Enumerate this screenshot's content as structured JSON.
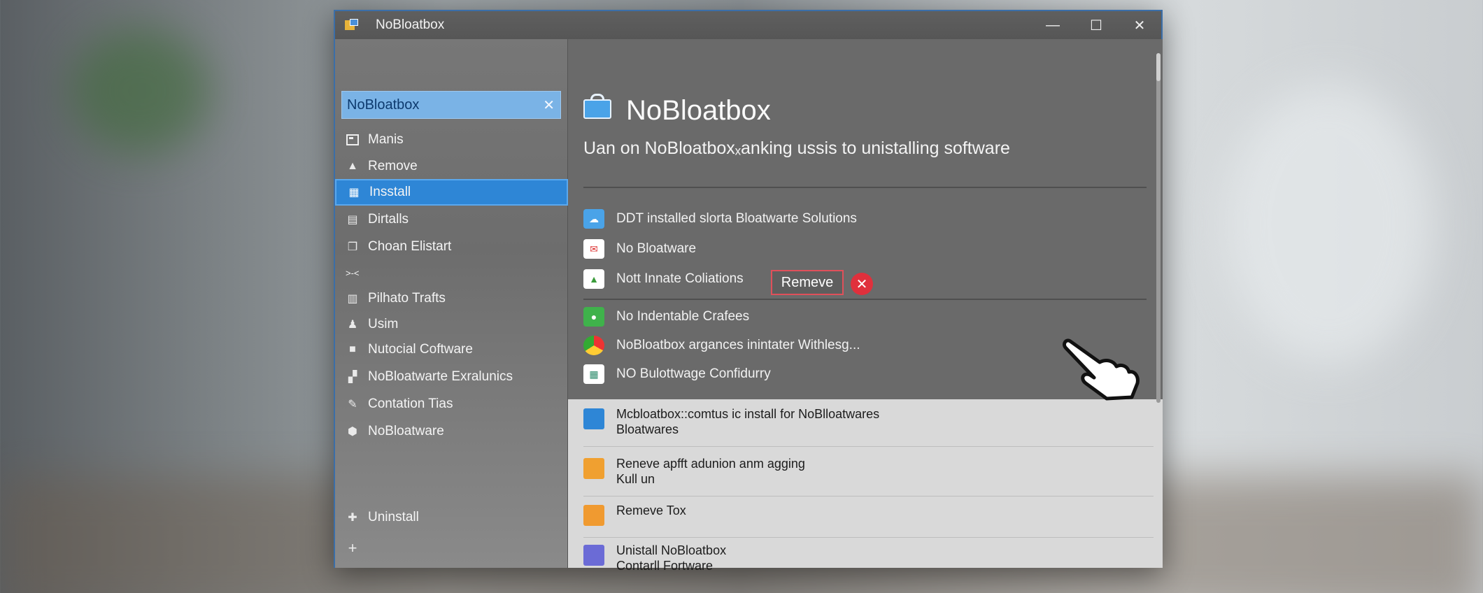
{
  "window": {
    "title": "NoBloatbox",
    "controls": {
      "minimize": "—",
      "maximize": "☐",
      "close": "✕"
    }
  },
  "sidebar": {
    "search": {
      "value": "NoBloatbox",
      "clear": "✕"
    },
    "items": [
      {
        "label": "Manis",
        "icon": "list-icon"
      },
      {
        "label": "Remove",
        "icon": "user-icon"
      },
      {
        "label": "Insstall",
        "icon": "grid-icon",
        "active": true
      },
      {
        "label": "Dirtalls",
        "icon": "document-icon"
      },
      {
        "label": "Choan Elistart",
        "icon": "copy-icon"
      },
      {
        "label": ">-<",
        "icon": ""
      },
      {
        "label": "Pilhato Trafts",
        "icon": "chart-icon"
      },
      {
        "label": "Usim",
        "icon": "person-icon"
      },
      {
        "label": "Nutocial Coftware",
        "icon": "bag-icon"
      },
      {
        "label": "NoBloatwarte Exralunics",
        "icon": "apps-icon"
      },
      {
        "label": "Contation Tias",
        "icon": "wrench-icon"
      },
      {
        "label": "NoBloatware",
        "icon": "hexagon-icon"
      }
    ],
    "bottom": [
      {
        "label": "Uninstall",
        "icon": "plus-icon"
      },
      {
        "label": "",
        "icon": "plus-icon"
      }
    ]
  },
  "main": {
    "title": "NoBloatbox",
    "subtitle": "Uan on NoBloatboxₓanking ussis to unistalling software",
    "rows": [
      {
        "label": "DDT installed slorta Bloatwarte Solutions",
        "icon": "cloud-icon",
        "color": "#4aa3e8"
      },
      {
        "label": "No Bloatware",
        "icon": "mail-icon",
        "color": "#ffffff"
      },
      {
        "label": "Nott Innate Coliations",
        "icon": "photo-icon",
        "color": "#ffffff"
      }
    ],
    "remove_button": "Remeve",
    "remove_x": "✕",
    "rows2": [
      {
        "label": "No Indentable Crafees",
        "icon": "shield-icon",
        "color": "#3fb24b"
      },
      {
        "label": "NoBloatbox argances inintater Withlesg...",
        "icon": "chrome-icon",
        "color": "#ffffff"
      },
      {
        "label": "NO Bulottwage Confidurry",
        "icon": "apps-icon",
        "color": "#ffffff"
      }
    ],
    "light_rows": [
      {
        "line1": "Mcbloatbox::comtus ic install for NoBlloatwares",
        "line2": "Bloatwares",
        "icon": "windows-icon",
        "color": "#2e86d6"
      },
      {
        "line1": "Reneve apfft adunion anm agging",
        "line2": "Kull un",
        "icon": "store-icon",
        "color": "#f0a030"
      },
      {
        "line1": "Remeve Tox",
        "line2": "",
        "icon": "folder-icon",
        "color": "#f09a30"
      },
      {
        "line1": "Unistall NoBloatbox",
        "line2": "Contarll Fortware",
        "icon": "apps-icon",
        "color": "#6b6bd6"
      }
    ]
  }
}
